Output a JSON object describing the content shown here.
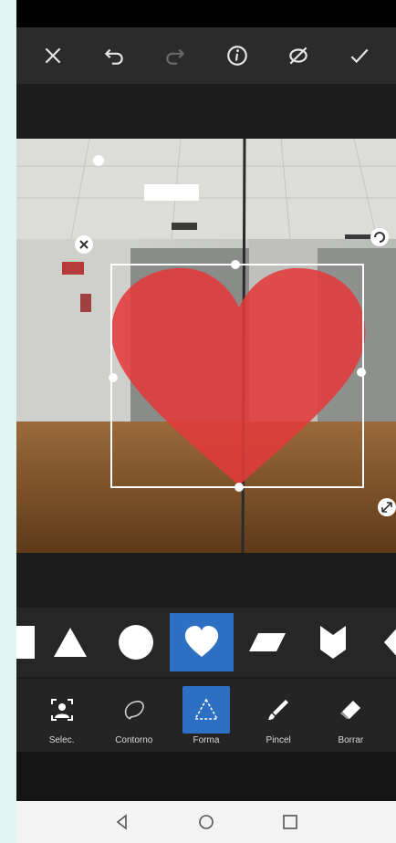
{
  "toolbar": {
    "icons": [
      "close-icon",
      "undo-icon",
      "redo-icon",
      "info-icon",
      "compare-icon",
      "check-icon"
    ]
  },
  "canvas": {
    "shape_color": "#e23a3a",
    "frame_color": "#ffffff"
  },
  "shapes": {
    "items": [
      "square",
      "triangle",
      "circle",
      "heart",
      "parallelogram",
      "chevron",
      "diamond"
    ],
    "selected": "heart",
    "accent_color": "#2d6fc2"
  },
  "tools": {
    "items": [
      {
        "id": "select",
        "label": "Selec.",
        "icon": "person-select-icon"
      },
      {
        "id": "contour",
        "label": "Contorno",
        "icon": "lasso-icon"
      },
      {
        "id": "shape",
        "label": "Forma",
        "icon": "triangle-dashed-icon"
      },
      {
        "id": "brush",
        "label": "Pincel",
        "icon": "brush-icon"
      },
      {
        "id": "erase",
        "label": "Borrar",
        "icon": "eraser-icon"
      }
    ],
    "active": "shape"
  },
  "navbar": {
    "icons": [
      "back-icon",
      "home-icon",
      "recents-icon"
    ]
  }
}
